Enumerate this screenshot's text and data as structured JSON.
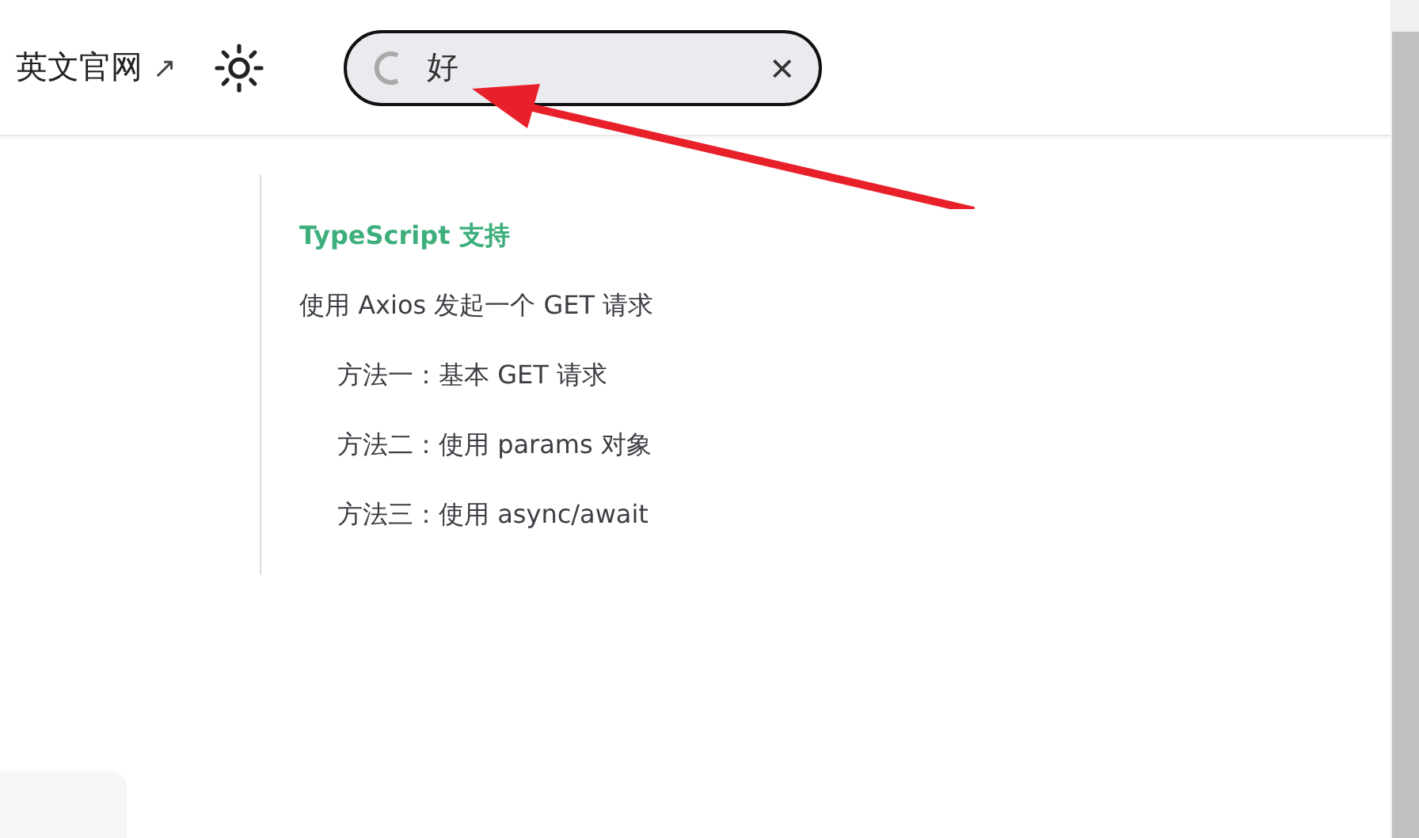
{
  "nav": {
    "link": {
      "label": "英文官网",
      "arrow": "↗"
    }
  },
  "search": {
    "value": "好",
    "loading": true,
    "clear": "×"
  },
  "outline": [
    {
      "label": "TypeScript 支持",
      "selected": true
    },
    {
      "label": "使用 Axios 发起一个 GET 请求",
      "selected": false,
      "children": [
        {
          "label": "方法一：基本 GET 请求",
          "selected": false
        },
        {
          "label": "方法二：使用 params 对象",
          "selected": false
        },
        {
          "label": "方法三：使用 async/await",
          "selected": false
        }
      ]
    }
  ]
}
